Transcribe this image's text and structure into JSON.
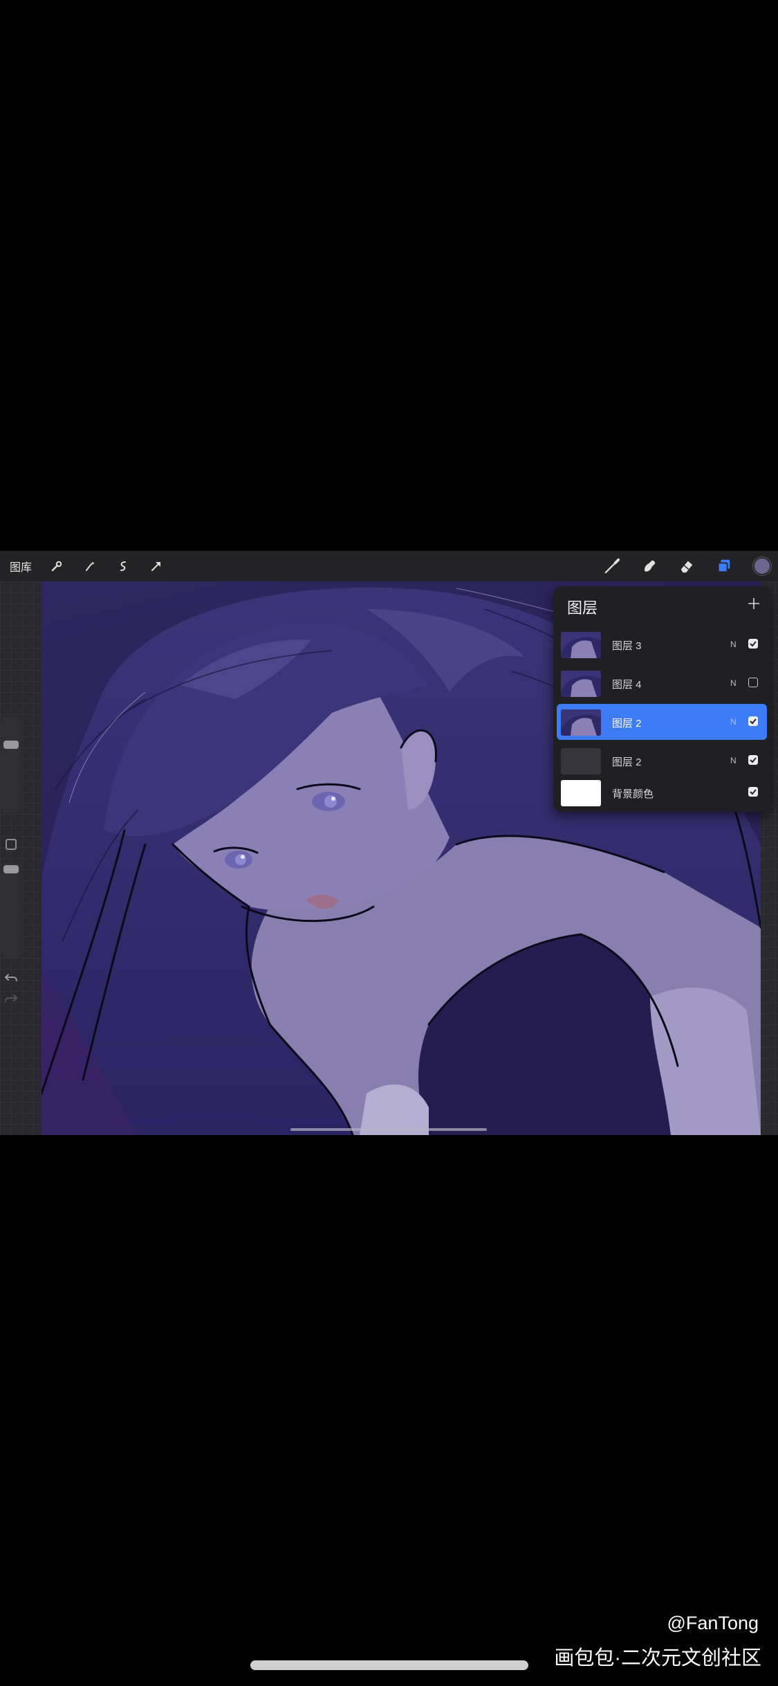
{
  "toolbar": {
    "gallery_label": "图库",
    "left_icons": [
      "wrench-icon",
      "magic-wand-icon",
      "selection-icon",
      "transform-arrow-icon"
    ],
    "right_icons": [
      "brush-icon",
      "smudge-icon",
      "eraser-icon",
      "layers-icon"
    ],
    "active_tool": "layers-icon",
    "accent_color": "#3c7cf6",
    "current_color": "#6f6690"
  },
  "layers_panel": {
    "title": "图层",
    "add_icon": "plus-icon",
    "layers": [
      {
        "name": "图层 3",
        "blend": "N",
        "visible": true,
        "active": false
      },
      {
        "name": "图层 4",
        "blend": "N",
        "visible": false,
        "active": false
      },
      {
        "name": "图层 2",
        "blend": "N",
        "visible": true,
        "active": true
      },
      {
        "name": "图层 2",
        "blend": "N",
        "visible": true,
        "active": false
      },
      {
        "name": "背景颜色",
        "blend": "",
        "visible": true,
        "active": false
      }
    ]
  },
  "sidebar": {
    "brush_size_level": 0.15,
    "opacity_level": 0.03
  },
  "watermark": {
    "author": "@FanTong",
    "site": "画包包·二次元文创社区"
  }
}
